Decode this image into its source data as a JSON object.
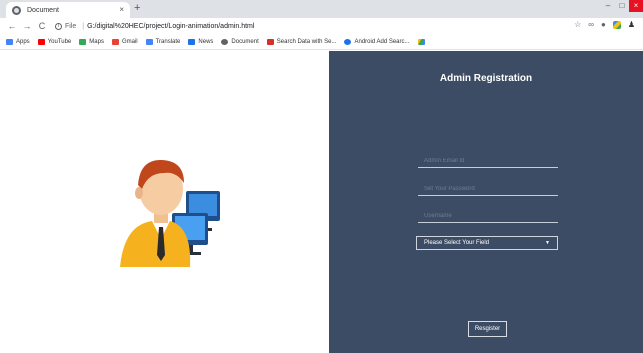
{
  "browser": {
    "tab": {
      "title": "Document",
      "close": "×"
    },
    "new_tab": "+",
    "window": {
      "minimize": "–",
      "maximize": "□",
      "close": "×"
    },
    "nav": {
      "back": "←",
      "forward": "→",
      "reload": "C"
    },
    "address": {
      "scheme": "File",
      "separator": "|",
      "url": "G:/digital%20HEC/project/Login-animation/admin.html"
    },
    "toolbar_icons": [
      "star-icon",
      "link-icon",
      "circle-icon",
      "extension-icon",
      "avatar-icon"
    ]
  },
  "bookmarks": [
    {
      "label": "Apps",
      "icon": "apps-icon",
      "color": "#4285f4"
    },
    {
      "label": "YouTube",
      "icon": "youtube-icon",
      "color": "#ff0000"
    },
    {
      "label": "Maps",
      "icon": "maps-icon",
      "color": "#34a853"
    },
    {
      "label": "Gmail",
      "icon": "gmail-icon",
      "color": "#ea4335"
    },
    {
      "label": "Translate",
      "icon": "translate-icon",
      "color": "#4285f4"
    },
    {
      "label": "News",
      "icon": "news-icon",
      "color": "#1a73e8"
    },
    {
      "label": "Document",
      "icon": "document-icon",
      "color": "#5f6368"
    },
    {
      "label": "Search Data with Se...",
      "icon": "search-data-icon",
      "color": "#d93025"
    },
    {
      "label": "Android Add Searc...",
      "icon": "android-icon",
      "color": "#1a73e8"
    },
    {
      "label": "",
      "icon": "drive-icon",
      "color": "#34a853"
    }
  ],
  "form": {
    "title": "Admin Registration",
    "email_placeholder": "Admin Email Id",
    "password_placeholder": "Set Your Password",
    "username_placeholder": "Username",
    "field_select": "Please Select Your Field",
    "register_label": "Resgister",
    "panel_color": "#3d4c65"
  }
}
